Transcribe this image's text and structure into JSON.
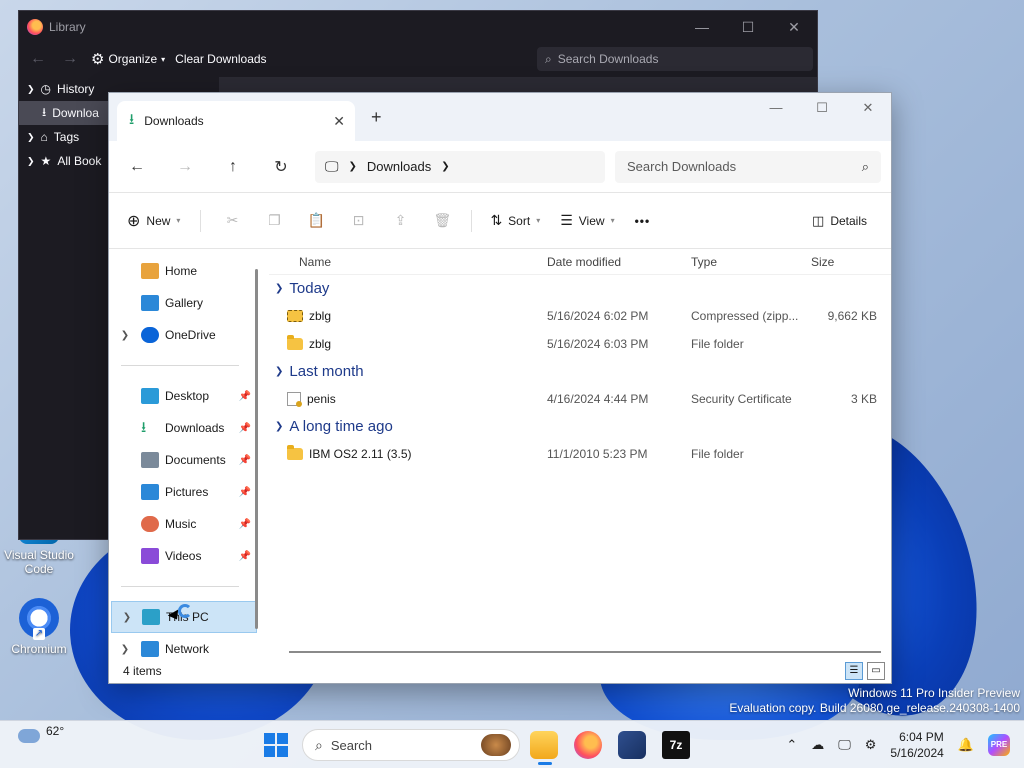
{
  "desktop": {
    "icons": [
      {
        "label": "Visual Studio Code"
      },
      {
        "label": "Chromium"
      }
    ],
    "watermark": {
      "line1": "Windows 11 Pro Insider Preview",
      "line2": "Evaluation copy. Build 26080.ge_release.240308-1400"
    }
  },
  "library": {
    "title": "Library",
    "toolbar": {
      "organize": "Organize",
      "clear": "Clear Downloads",
      "search_placeholder": "Search Downloads"
    },
    "sidebar": [
      {
        "label": "History",
        "icon": "clock-icon"
      },
      {
        "label": "Downloa",
        "icon": "download-icon"
      },
      {
        "label": "Tags",
        "icon": "tag-icon"
      },
      {
        "label": "All Book",
        "icon": "star-icon"
      }
    ]
  },
  "explorer": {
    "tab_title": "Downloads",
    "address": {
      "location": "Downloads"
    },
    "search_placeholder": "Search Downloads",
    "commands": {
      "new": "New",
      "sort": "Sort",
      "view": "View",
      "more": "•••",
      "details": "Details"
    },
    "nav": [
      {
        "label": "Home",
        "icon": "home-icon",
        "color": "#e8a33d"
      },
      {
        "label": "Gallery",
        "icon": "gallery-icon",
        "color": "#2b88d8"
      },
      {
        "label": "OneDrive",
        "icon": "onedrive-icon",
        "color": "#0a64d8"
      },
      {
        "label": "Desktop",
        "icon": "desktop-icon",
        "color": "#2b9ad8"
      },
      {
        "label": "Downloads",
        "icon": "download-icon",
        "color": "#1f9e6b"
      },
      {
        "label": "Documents",
        "icon": "documents-icon",
        "color": "#7b8a9a"
      },
      {
        "label": "Pictures",
        "icon": "pictures-icon",
        "color": "#2b88d8"
      },
      {
        "label": "Music",
        "icon": "music-icon",
        "color": "#e06a4a"
      },
      {
        "label": "Videos",
        "icon": "videos-icon",
        "color": "#8a4bd8"
      },
      {
        "label": "This PC",
        "icon": "pc-icon",
        "color": "#2ba0c8"
      },
      {
        "label": "Network",
        "icon": "network-icon",
        "color": "#2b88d8"
      }
    ],
    "columns": {
      "name": "Name",
      "date": "Date modified",
      "type": "Type",
      "size": "Size"
    },
    "groups": [
      {
        "label": "Today",
        "rows": [
          {
            "name": "zblg",
            "date": "5/16/2024 6:02 PM",
            "type": "Compressed (zipp...",
            "size": "9,662 KB",
            "icon": "zip-icon"
          },
          {
            "name": "zblg",
            "date": "5/16/2024 6:03 PM",
            "type": "File folder",
            "size": "",
            "icon": "folder-icon"
          }
        ]
      },
      {
        "label": "Last month",
        "rows": [
          {
            "name": "penis",
            "date": "4/16/2024 4:44 PM",
            "type": "Security Certificate",
            "size": "3 KB",
            "icon": "certificate-icon"
          }
        ]
      },
      {
        "label": "A long time ago",
        "rows": [
          {
            "name": "IBM OS2 2.11 (3.5)",
            "date": "11/1/2010 5:23 PM",
            "type": "File folder",
            "size": "",
            "icon": "folder-icon"
          }
        ]
      }
    ],
    "status": "4 items"
  },
  "taskbar": {
    "weather": "62°",
    "search": "Search",
    "sevenzip": "7z",
    "copilot": "PRE",
    "time": "6:04 PM",
    "date": "5/16/2024"
  }
}
